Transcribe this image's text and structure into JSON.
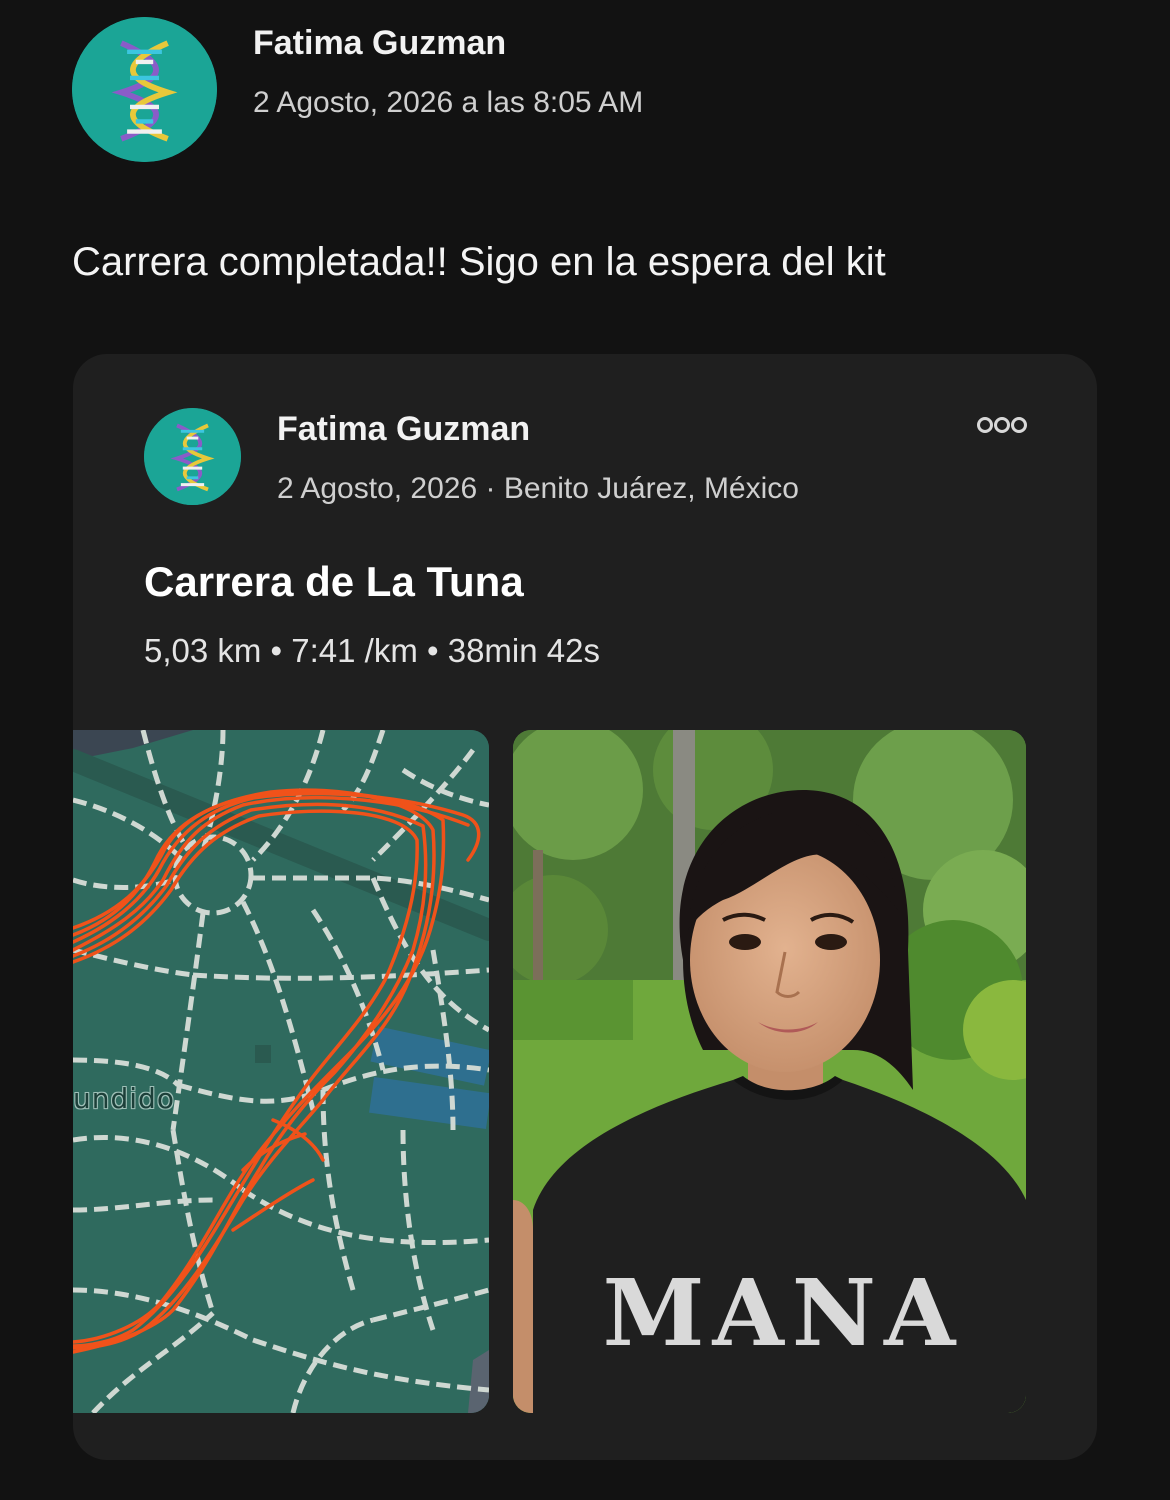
{
  "post": {
    "author": "Fatima Guzman",
    "timestamp": "2 Agosto, 2026 a las 8:05 AM",
    "avatar_icon": "dna-icon",
    "text": "Carrera completada!! Sigo en la espera del kit"
  },
  "activity": {
    "author": "Fatima Guzman",
    "meta": "2 Agosto, 2026 · Benito Juárez, México",
    "avatar_icon": "dna-icon",
    "more_icon": "more-options-icon",
    "title": "Carrera de La Tuna",
    "stats": "5,03 km • 7:41 /km • 38min 42s",
    "map": {
      "label": "undido",
      "route_color": "#f0521a",
      "park_color": "#2f6a5e"
    },
    "photo": {
      "shirt_text": "MANA"
    }
  }
}
